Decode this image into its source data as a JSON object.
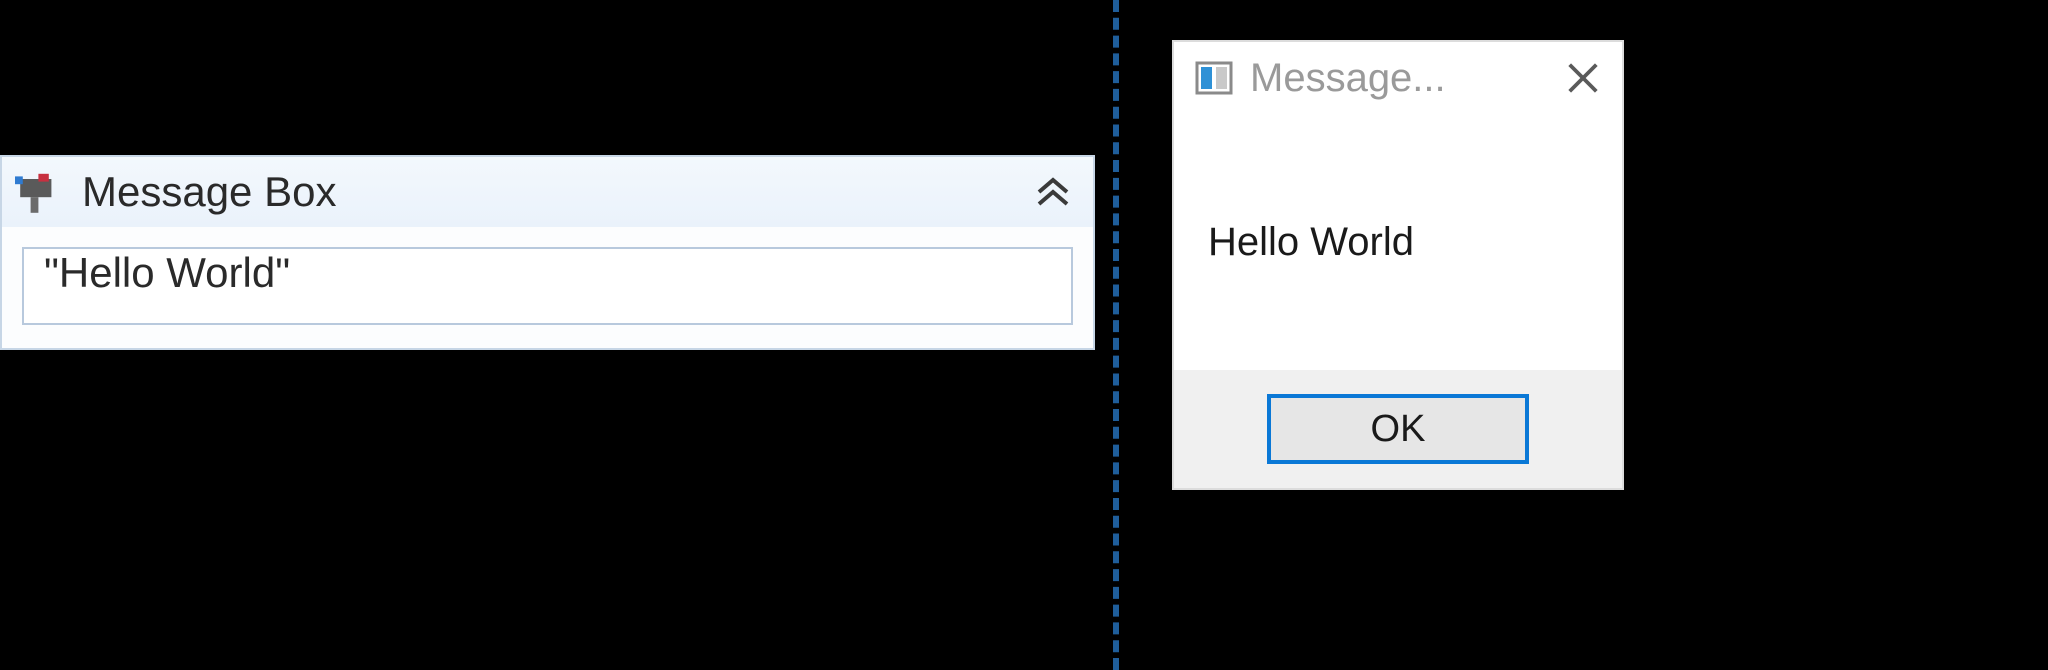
{
  "activity": {
    "title": "Message Box",
    "input_value": "\"Hello World\""
  },
  "dialog": {
    "title": "Message...",
    "body_text": "Hello World",
    "ok_label": "OK"
  },
  "colors": {
    "divider": "#1f5e9b",
    "button_focus_border": "#0a78d6"
  }
}
